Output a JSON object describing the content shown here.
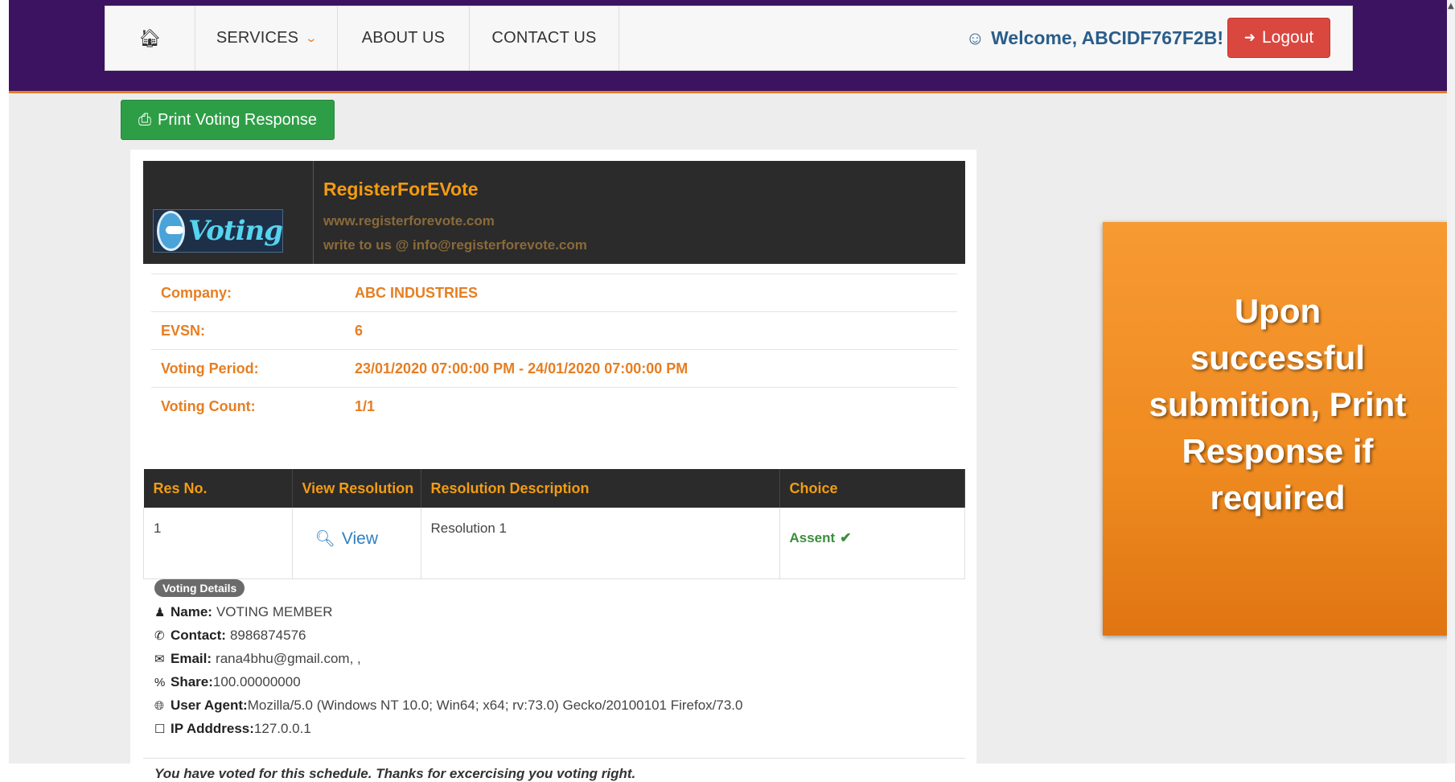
{
  "nav": {
    "home_icon": "home-icon",
    "services": "SERVICES",
    "about": "ABOUT US",
    "contact": "CONTACT US",
    "welcome": "Welcome, ABCIDF767F2B!",
    "logout": "Logout"
  },
  "actions": {
    "print_label": "Print Voting Response"
  },
  "brand": {
    "logo_text": "Voting",
    "name": "RegisterForEVote",
    "website": "www.registerforevote.com",
    "email_line": "write to us @ info@registerforevote.com"
  },
  "info": [
    {
      "label": "Company:",
      "value": "ABC INDUSTRIES"
    },
    {
      "label": "EVSN:",
      "value": "6"
    },
    {
      "label": "Voting Period:",
      "value": "23/01/2020 07:00:00 PM - 24/01/2020 07:00:00 PM"
    },
    {
      "label": "Voting Count:",
      "value": "1/1"
    }
  ],
  "resolutions": {
    "headers": [
      "Res No.",
      "View Resolution",
      "Resolution Description",
      "Choice"
    ],
    "rows": [
      {
        "no": "1",
        "view": "View",
        "description": "Resolution 1",
        "choice": "Assent"
      }
    ]
  },
  "details": {
    "badge": "Voting Details",
    "name_label": "Name:",
    "name": "VOTING MEMBER",
    "contact_label": "Contact:",
    "contact": "8986874576",
    "email_label": "Email:",
    "email": "rana4bhu@gmail.com, ,",
    "share_label": "Share:",
    "share": "100.00000000",
    "agent_label": "User Agent:",
    "agent": "Mozilla/5.0 (Windows NT 10.0; Win64; x64; rv:73.0) Gecko/20100101 Firefox/73.0",
    "ip_label": "IP Adddress:",
    "ip": "127.0.0.1"
  },
  "footnote": "You have voted for this schedule. Thanks for excercising you voting right.",
  "callout": "Upon successful submition, Print Response if required",
  "colors": {
    "accent": "#e67e22",
    "header_band": "#3c1361",
    "success": "#2e9e46",
    "danger": "#d9473f"
  }
}
